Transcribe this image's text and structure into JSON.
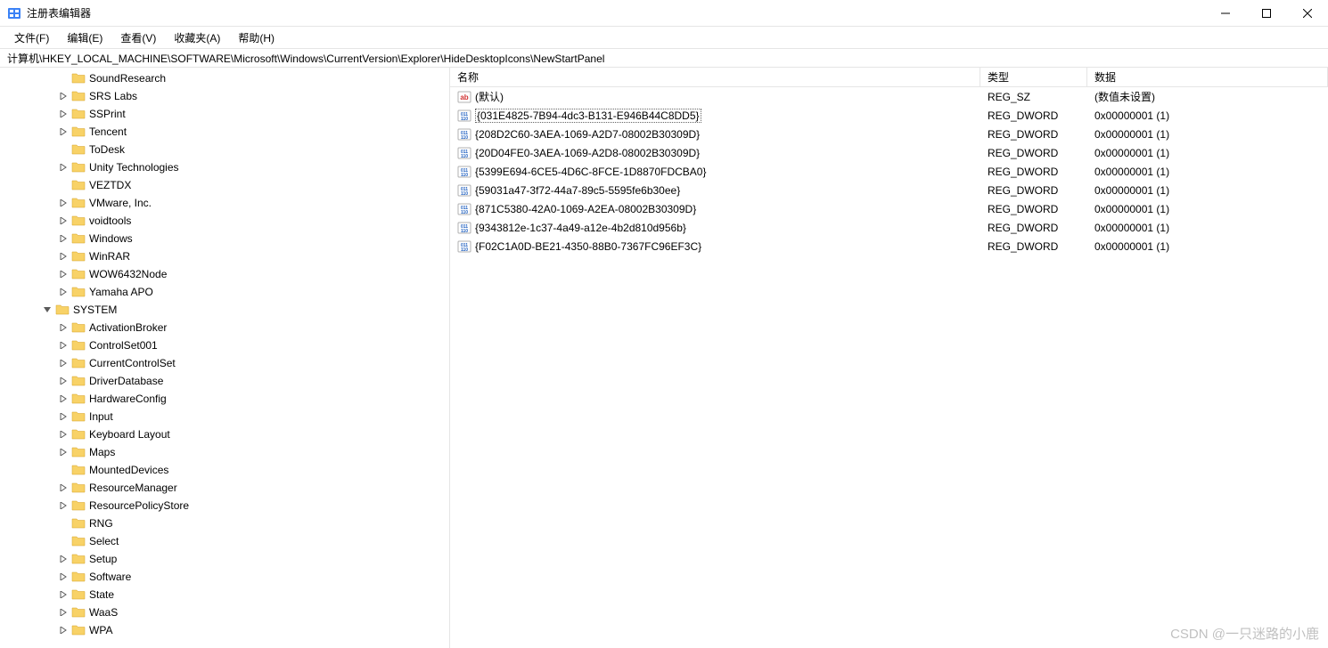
{
  "window": {
    "title": "注册表编辑器"
  },
  "menu": {
    "file": "文件(F)",
    "edit": "编辑(E)",
    "view": "查看(V)",
    "favorites": "收藏夹(A)",
    "help": "帮助(H)"
  },
  "address": "计算机\\HKEY_LOCAL_MACHINE\\SOFTWARE\\Microsoft\\Windows\\CurrentVersion\\Explorer\\HideDesktopIcons\\NewStartPanel",
  "columns": {
    "name": "名称",
    "type": "类型",
    "data": "数据"
  },
  "tree": [
    {
      "indent": 3,
      "exp": "none",
      "label": "SoundResearch"
    },
    {
      "indent": 3,
      "exp": "closed",
      "label": "SRS Labs"
    },
    {
      "indent": 3,
      "exp": "closed",
      "label": "SSPrint"
    },
    {
      "indent": 3,
      "exp": "closed",
      "label": "Tencent"
    },
    {
      "indent": 3,
      "exp": "none",
      "label": "ToDesk"
    },
    {
      "indent": 3,
      "exp": "closed",
      "label": "Unity Technologies"
    },
    {
      "indent": 3,
      "exp": "none",
      "label": "VEZTDX"
    },
    {
      "indent": 3,
      "exp": "closed",
      "label": "VMware, Inc."
    },
    {
      "indent": 3,
      "exp": "closed",
      "label": "voidtools"
    },
    {
      "indent": 3,
      "exp": "closed",
      "label": "Windows"
    },
    {
      "indent": 3,
      "exp": "closed",
      "label": "WinRAR"
    },
    {
      "indent": 3,
      "exp": "closed",
      "label": "WOW6432Node"
    },
    {
      "indent": 3,
      "exp": "closed",
      "label": "Yamaha APO"
    },
    {
      "indent": 2,
      "exp": "open",
      "label": "SYSTEM"
    },
    {
      "indent": 3,
      "exp": "closed",
      "label": "ActivationBroker"
    },
    {
      "indent": 3,
      "exp": "closed",
      "label": "ControlSet001"
    },
    {
      "indent": 3,
      "exp": "closed",
      "label": "CurrentControlSet"
    },
    {
      "indent": 3,
      "exp": "closed",
      "label": "DriverDatabase"
    },
    {
      "indent": 3,
      "exp": "closed",
      "label": "HardwareConfig"
    },
    {
      "indent": 3,
      "exp": "closed",
      "label": "Input"
    },
    {
      "indent": 3,
      "exp": "closed",
      "label": "Keyboard Layout"
    },
    {
      "indent": 3,
      "exp": "closed",
      "label": "Maps"
    },
    {
      "indent": 3,
      "exp": "none",
      "label": "MountedDevices"
    },
    {
      "indent": 3,
      "exp": "closed",
      "label": "ResourceManager"
    },
    {
      "indent": 3,
      "exp": "closed",
      "label": "ResourcePolicyStore"
    },
    {
      "indent": 3,
      "exp": "none",
      "label": "RNG"
    },
    {
      "indent": 3,
      "exp": "none",
      "label": "Select"
    },
    {
      "indent": 3,
      "exp": "closed",
      "label": "Setup"
    },
    {
      "indent": 3,
      "exp": "closed",
      "label": "Software"
    },
    {
      "indent": 3,
      "exp": "closed",
      "label": "State"
    },
    {
      "indent": 3,
      "exp": "closed",
      "label": "WaaS"
    },
    {
      "indent": 3,
      "exp": "closed",
      "label": "WPA"
    }
  ],
  "values": [
    {
      "icon": "string",
      "name": "(默认)",
      "type": "REG_SZ",
      "data": "(数值未设置)",
      "selected": false
    },
    {
      "icon": "dword",
      "name": "{031E4825-7B94-4dc3-B131-E946B44C8DD5}",
      "type": "REG_DWORD",
      "data": "0x00000001 (1)",
      "selected": true
    },
    {
      "icon": "dword",
      "name": "{208D2C60-3AEA-1069-A2D7-08002B30309D}",
      "type": "REG_DWORD",
      "data": "0x00000001 (1)",
      "selected": false
    },
    {
      "icon": "dword",
      "name": "{20D04FE0-3AEA-1069-A2D8-08002B30309D}",
      "type": "REG_DWORD",
      "data": "0x00000001 (1)",
      "selected": false
    },
    {
      "icon": "dword",
      "name": "{5399E694-6CE5-4D6C-8FCE-1D8870FDCBA0}",
      "type": "REG_DWORD",
      "data": "0x00000001 (1)",
      "selected": false
    },
    {
      "icon": "dword",
      "name": "{59031a47-3f72-44a7-89c5-5595fe6b30ee}",
      "type": "REG_DWORD",
      "data": "0x00000001 (1)",
      "selected": false
    },
    {
      "icon": "dword",
      "name": "{871C5380-42A0-1069-A2EA-08002B30309D}",
      "type": "REG_DWORD",
      "data": "0x00000001 (1)",
      "selected": false
    },
    {
      "icon": "dword",
      "name": "{9343812e-1c37-4a49-a12e-4b2d810d956b}",
      "type": "REG_DWORD",
      "data": "0x00000001 (1)",
      "selected": false
    },
    {
      "icon": "dword",
      "name": "{F02C1A0D-BE21-4350-88B0-7367FC96EF3C}",
      "type": "REG_DWORD",
      "data": "0x00000001 (1)",
      "selected": false
    }
  ],
  "watermark": "CSDN @一只迷路的小鹿"
}
